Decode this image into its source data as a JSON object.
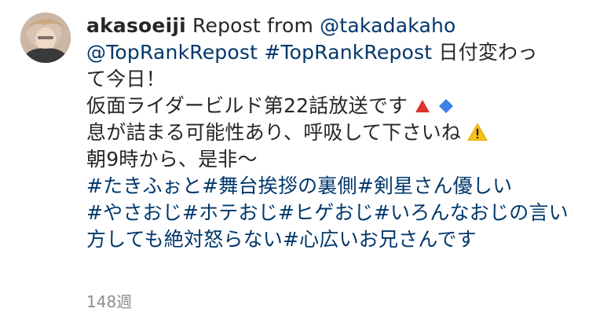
{
  "comment": {
    "username": "akasoeiji",
    "repost_text": "Repost from",
    "mention_takadakaho": "@takadakaho",
    "mention_toprank": "@TopRankRepost",
    "hashtag_toprank": "#TopRankRepost",
    "line1_tail": "日付変わっ",
    "line2": "て今日！",
    "line3_text": "仮面ライダービルド第22話放送です",
    "line4_text": "息が詰まる可能性あり、呼吸して下さいね",
    "line5_text": "朝9時から、是非〜",
    "hashtags": [
      "#たきふぉと",
      "#舞台挨拶の裏側",
      "#剣星さん優しい",
      "#やさおじ",
      "#ホテおじ",
      "#ヒゲおじ",
      "#いろんなおじの言い方しても絶対怒らない",
      "#心広いお兄さんです"
    ],
    "meta_time": "148週"
  },
  "colors": {
    "text": "#262626",
    "link": "#00376b",
    "meta": "#8e8e8e",
    "warning_yellow": "#f7c31a",
    "red_triangle": "#e0332b",
    "blue_diamond": "#3b82e6"
  },
  "icons": [
    "avatar",
    "red-triangle-icon",
    "blue-diamond-icon",
    "warning-icon"
  ]
}
